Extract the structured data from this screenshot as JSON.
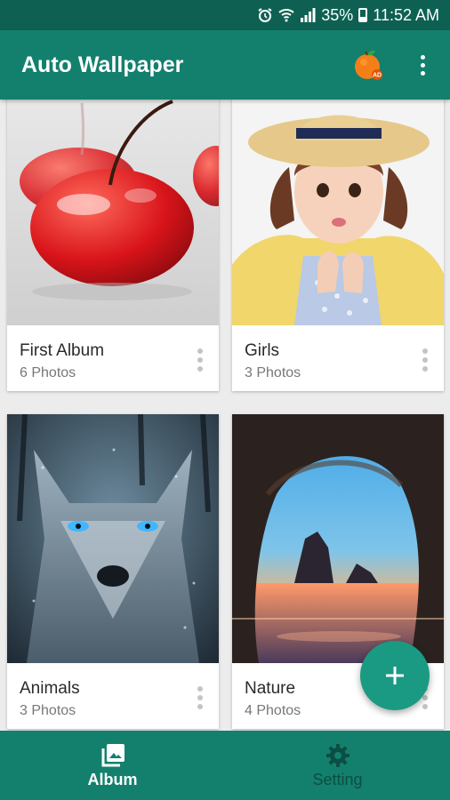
{
  "status_bar": {
    "battery": "35%",
    "time": "11:52 AM"
  },
  "app_bar": {
    "title": "Auto Wallpaper",
    "ad_badge": "AD"
  },
  "albums": [
    {
      "name": "First Album",
      "count": "6 Photos",
      "image": "cherry-photo"
    },
    {
      "name": "Girls",
      "count": "3 Photos",
      "image": "girl-photo"
    },
    {
      "name": "Animals",
      "count": "3 Photos",
      "image": "wolf-photo"
    },
    {
      "name": "Nature",
      "count": "4 Photos",
      "image": "sea-cave-photo"
    }
  ],
  "fab": {
    "icon": "plus-icon"
  },
  "bottom_nav": [
    {
      "label": "Album",
      "icon": "photo-album-icon",
      "active": true
    },
    {
      "label": "Setting",
      "icon": "gear-icon",
      "active": false
    }
  ],
  "colors": {
    "primary": "#13806d",
    "primary_dark": "#0e6152",
    "accent": "#1a9a83"
  }
}
